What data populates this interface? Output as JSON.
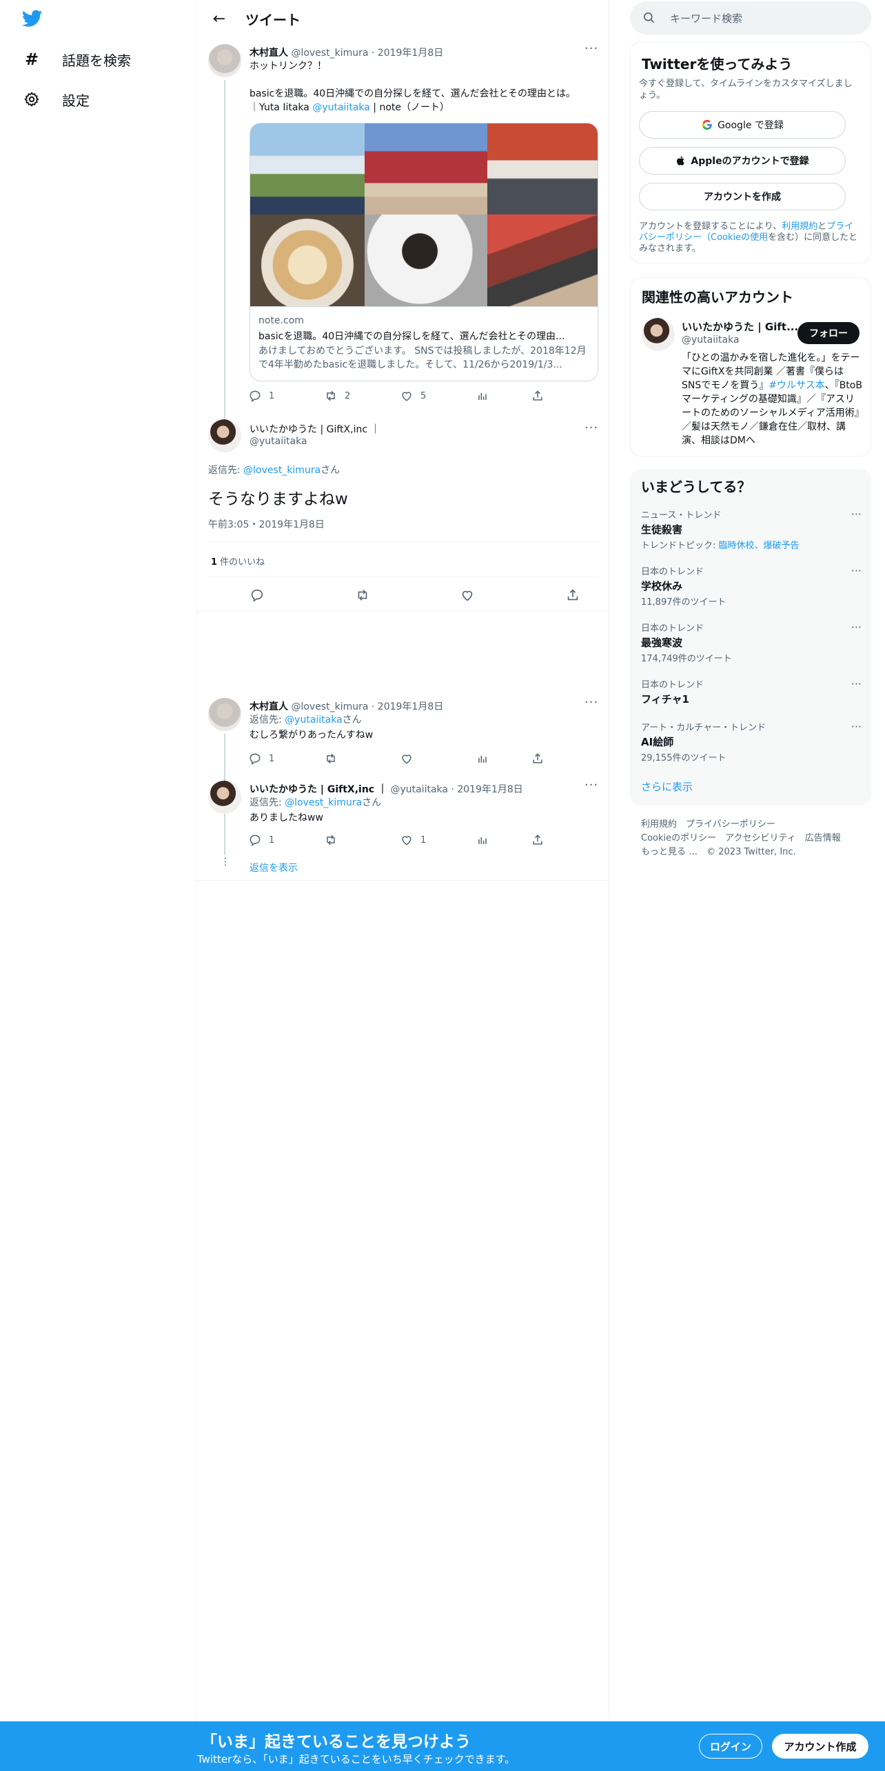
{
  "nav": {
    "items": [
      {
        "icon": "hashtag-icon",
        "label": "話題を検索"
      },
      {
        "icon": "gear-icon",
        "label": "設定"
      }
    ]
  },
  "header": {
    "title": "ツイート"
  },
  "tweets": [
    {
      "name": "木村直人",
      "handle": "@lovest_kimura",
      "date": "2019年1月8日",
      "line1": "ホットリンク？！",
      "line2": "basicを退職。40日沖縄での自分探しを経て、選んだ会社とその理由とは。",
      "line3_pre": "｜Yuta Iitaka ",
      "line3_link": "@yutaiitaka",
      "line3_post": " | note（ノート）",
      "card": {
        "domain": "note.com",
        "title": "basicを退職。40日沖縄での自分探しを経て、選んだ会社とその理由...",
        "desc": "あけましておめでとうございます。 SNSでは投稿しましたが、2018年12月で4年半勤めたbasicを退職しました。そして、11/26から2019/1/3..."
      },
      "replies": "1",
      "retweets": "2",
      "likes": "5"
    }
  ],
  "focus": {
    "name": "いいたかゆうた | GiftX,inc ｜",
    "handle": "@yutaiitaka",
    "reply_to_pre": "返信先: ",
    "reply_to_link": "@lovest_kimura",
    "reply_to_post": "さん",
    "text": "そうなりますよねw",
    "time": "午前3:05・2019年1月8日",
    "like_count": "1",
    "like_label": " 件のいいね"
  },
  "replies": [
    {
      "name": "木村直人",
      "handle": "@lovest_kimura",
      "date": "2019年1月8日",
      "reply_to_pre": "返信先: ",
      "reply_to_link": "@yutaiitaka",
      "reply_to_post": "さん",
      "text": "むしろ繋がりあったんすねw",
      "replies": "1",
      "retweets": "",
      "likes": ""
    },
    {
      "name": "いいたかゆうた | GiftX,inc ｜",
      "handle": "@yutaiitaka",
      "date": "2019年1月8日",
      "reply_to_pre": "返信先: ",
      "reply_to_link": "@lovest_kimura",
      "reply_to_post": "さん",
      "text": "ありましたねww",
      "replies": "1",
      "retweets": "",
      "likes": "1"
    }
  ],
  "show_replies": "返信を表示",
  "right": {
    "search_placeholder": "キーワード検索",
    "signup": {
      "title": "Twitterを使ってみよう",
      "desc": "今すぐ登録して、タイムラインをカスタマイズしましょう。",
      "google": "Google で登録",
      "apple": "Appleのアカウントで登録",
      "create": "アカウントを作成",
      "terms_1": "アカウントを登録することにより、",
      "terms_link1": "利用規約",
      "terms_2": "と",
      "terms_link2": "プライバシーポリシー（Cookieの使用",
      "terms_3": "を含む）に同意したとみなされます。"
    },
    "related": {
      "title": "関連性の高いアカウント",
      "name": "いいたかゆうた | Gift...",
      "handle": "@yutaiitaka",
      "follow": "フォロー",
      "bio_1": "「ひとの温かみを宿した進化を。」をテーマにGiftXを共同創業 ／著書『僕らはSNSでモノを買う』",
      "bio_link": "#ウルサス本",
      "bio_2": "、『BtoBマーケティングの基礎知識』／『アスリートのためのソーシャルメディア活用術』／髪は天然モノ／鎌倉在住／取材、講演、相談はDMへ"
    },
    "trends": {
      "title": "いまどうしてる？",
      "items": [
        {
          "cat": "ニュース・トレンド",
          "name": "生徒殺害",
          "sub_pre": "トレンドトピック: ",
          "sub_link": "臨時休校、爆破予告",
          "sub": ""
        },
        {
          "cat": "日本のトレンド",
          "name": "学校休み",
          "sub_pre": "",
          "sub_link": "",
          "sub": "11,897件のツイート"
        },
        {
          "cat": "日本のトレンド",
          "name": "最強寒波",
          "sub_pre": "",
          "sub_link": "",
          "sub": "174,749件のツイート"
        },
        {
          "cat": "日本のトレンド",
          "name": "フィチャ1",
          "sub_pre": "",
          "sub_link": "",
          "sub": ""
        },
        {
          "cat": "アート・カルチャー・トレンド",
          "name": "AI絵師",
          "sub_pre": "",
          "sub_link": "",
          "sub": "29,155件のツイート"
        }
      ],
      "more": "さらに表示"
    },
    "footer": {
      "line1": "利用規約　プライバシーポリシー",
      "line2": "Cookieのポリシー　アクセシビリティ　広告情報",
      "line3": "もっと見る …　© 2023 Twitter, Inc."
    }
  },
  "bottom": {
    "headline": "「いま」起きていることを見つけよう",
    "sub": "Twitterなら、「いま」起きていることをいち早くチェックできます。",
    "login": "ログイン",
    "signup": "アカウント作成"
  }
}
